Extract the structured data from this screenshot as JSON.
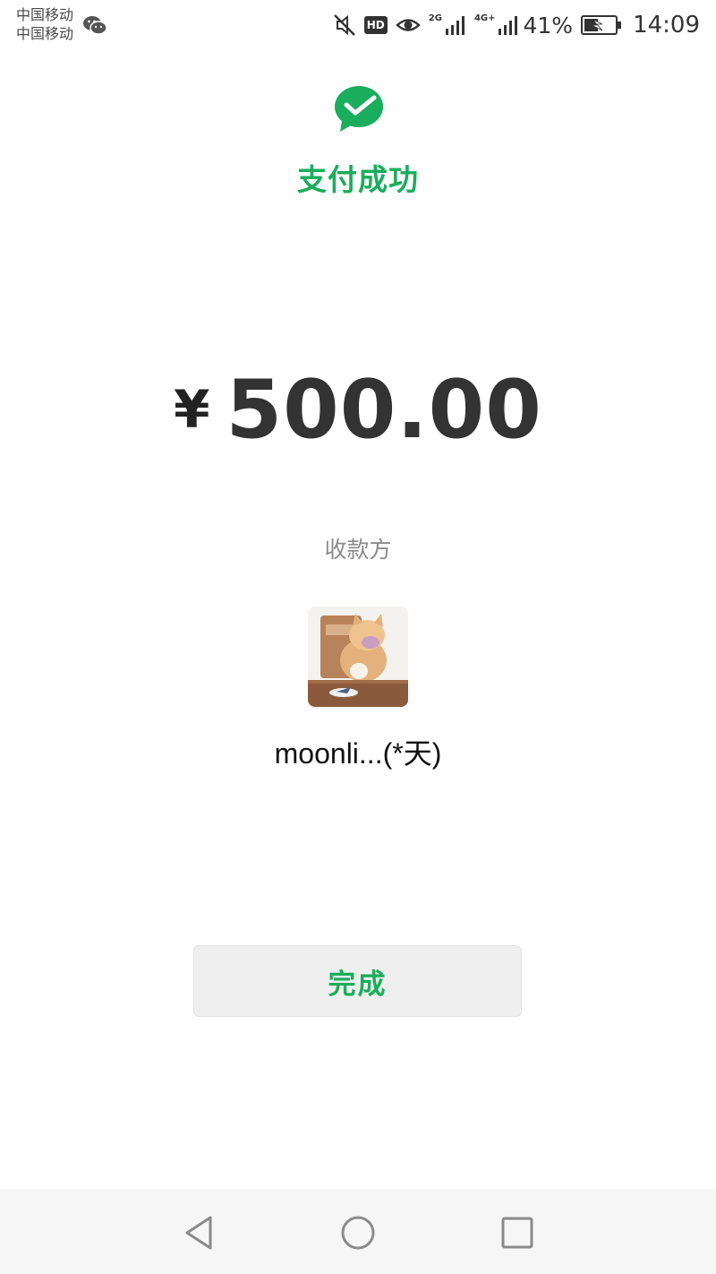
{
  "status_bar": {
    "carrier_1": "中国移动",
    "carrier_2": "中国移动",
    "hd_badge": "HD",
    "network_1": "2G",
    "network_2": "4G+",
    "battery_percent": "41%",
    "time": "14:09",
    "icons": [
      "wechat-icon",
      "mute-icon",
      "eye-comfort-icon",
      "signal-icon",
      "battery-icon"
    ]
  },
  "header": {
    "logo_icon": "wechat-pay-icon",
    "title": "支付成功"
  },
  "payment": {
    "currency": "¥",
    "amount": "500.00",
    "payee_label": "收款方",
    "payee_name": "moonli...(*天)"
  },
  "actions": {
    "done_label": "完成"
  },
  "nav": {
    "icons": [
      "back-icon",
      "home-icon",
      "recent-apps-icon"
    ]
  },
  "colors": {
    "accent": "#1aad5b",
    "amount_text": "#333333",
    "secondary_text": "#8a8a8a",
    "button_bg": "#efefef",
    "nav_bg": "#f6f6f6"
  }
}
